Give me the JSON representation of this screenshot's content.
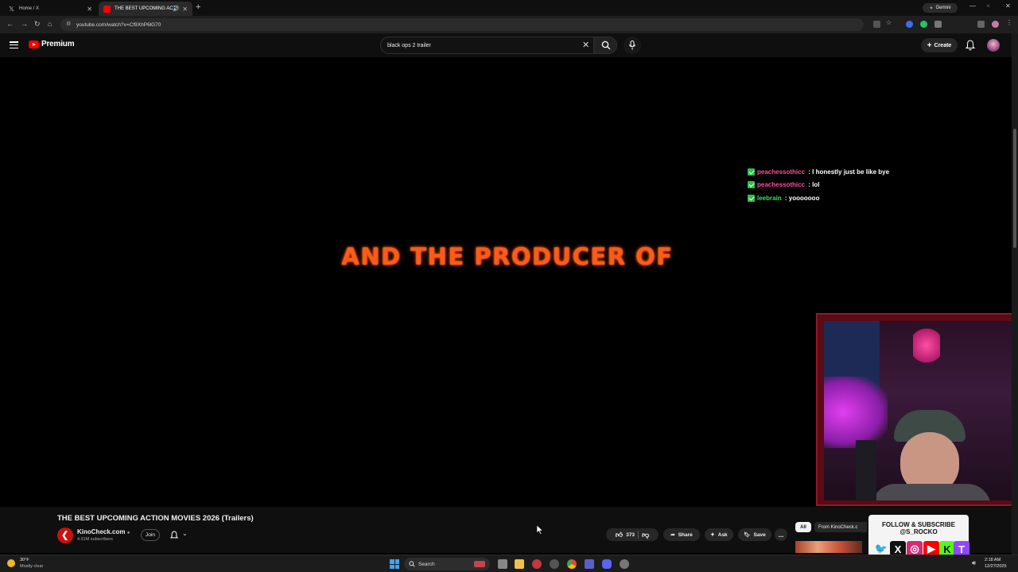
{
  "browser": {
    "tabs": [
      {
        "title": "Home / X",
        "icon": "x-logo-icon"
      },
      {
        "title": "THE BEST UPCOMING ACTI",
        "icon": "youtube-icon",
        "audio": true
      }
    ],
    "new_tab_symbol": "+",
    "gemini_label": "Gemini",
    "url": "youtube.com/watch?v=Cf9XhP6lG70"
  },
  "youtube_header": {
    "brand": "Premium",
    "search_value": "black ops 2 trailer",
    "create_label": "Create"
  },
  "video": {
    "overlay_text": "AND THE PRODUCER OF",
    "chat": [
      {
        "user": "peachessothicc",
        "sep": " : ",
        "message": "I honestly just be like bye",
        "user_color": "#ff4fa3"
      },
      {
        "user": "peachessothicc",
        "sep": " : ",
        "message": "lol",
        "user_color": "#ff4fa3"
      },
      {
        "user": "leebrain",
        "sep": " : ",
        "message": "yooooooo",
        "user_color": "#39e05a"
      }
    ]
  },
  "info": {
    "title": "THE BEST UPCOMING ACTION MOVIES 2026 (Trailers)",
    "channel": "KinoCheck.com",
    "subscribers": "4.91M subscribers",
    "join_label": "Join",
    "likes": "373",
    "share_label": "Share",
    "ask_label": "Ask",
    "save_label": "Save",
    "more_label": "...",
    "chip_all": "All",
    "chip_from": "From KinoCheck.c"
  },
  "follow_overlay": {
    "text": "FOLLOW & SUBSCRIBE @S_ROCKO",
    "socials": [
      {
        "name": "twitter-icon",
        "glyph": "🐦",
        "color": "#1da1f2"
      },
      {
        "name": "x-icon",
        "glyph": "X",
        "color": "#111111"
      },
      {
        "name": "instagram-icon",
        "glyph": "◎",
        "color": "#d62976"
      },
      {
        "name": "youtube-icon",
        "glyph": "▶",
        "color": "#ff0000"
      },
      {
        "name": "kick-icon",
        "glyph": "K",
        "color": "#53fc18"
      },
      {
        "name": "twitch-icon",
        "glyph": "T",
        "color": "#9146ff"
      }
    ]
  },
  "taskbar": {
    "weather_temp": "30°F",
    "weather_desc": "Mostly clear",
    "search_label": "Search",
    "time": "2:18 AM",
    "date": "12/27/2025"
  }
}
